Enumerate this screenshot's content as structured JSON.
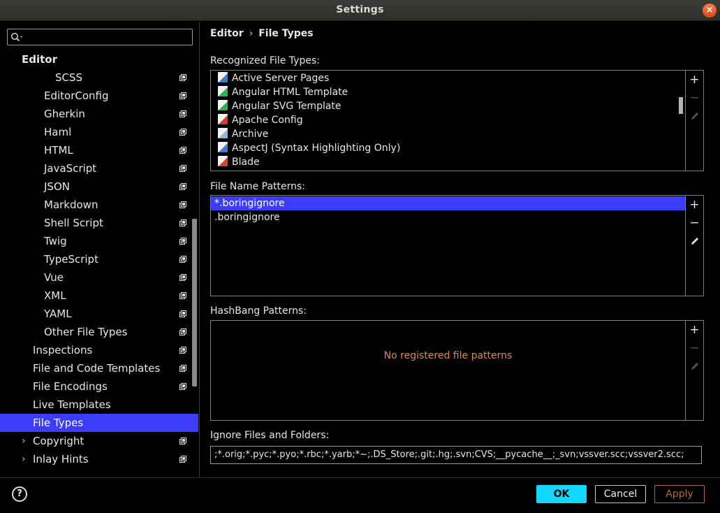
{
  "window": {
    "title": "Settings"
  },
  "search": {
    "placeholder": ""
  },
  "sidebar": {
    "section": "Editor",
    "items": [
      {
        "label": "SCSS",
        "indent": 3
      },
      {
        "label": "EditorConfig",
        "indent": 2
      },
      {
        "label": "Gherkin",
        "indent": 2
      },
      {
        "label": "Haml",
        "indent": 2
      },
      {
        "label": "HTML",
        "indent": 2
      },
      {
        "label": "JavaScript",
        "indent": 2
      },
      {
        "label": "JSON",
        "indent": 2
      },
      {
        "label": "Markdown",
        "indent": 2
      },
      {
        "label": "Shell Script",
        "indent": 2
      },
      {
        "label": "Twig",
        "indent": 2
      },
      {
        "label": "TypeScript",
        "indent": 2
      },
      {
        "label": "Vue",
        "indent": 2
      },
      {
        "label": "XML",
        "indent": 2
      },
      {
        "label": "YAML",
        "indent": 2
      },
      {
        "label": "Other File Types",
        "indent": 2
      },
      {
        "label": "Inspections",
        "indent": 1
      },
      {
        "label": "File and Code Templates",
        "indent": 1
      },
      {
        "label": "File Encodings",
        "indent": 1
      },
      {
        "label": "Live Templates",
        "indent": 1
      },
      {
        "label": "File Types",
        "indent": 1
      },
      {
        "label": "Copyright",
        "indent": 1
      },
      {
        "label": "Inlay Hints",
        "indent": 1
      }
    ]
  },
  "breadcrumb": {
    "parent": "Editor",
    "current": "File Types"
  },
  "recognized": {
    "label": "Recognized File Types:",
    "items": [
      {
        "label": "Active Server Pages",
        "icon": "asp-file-icon",
        "color": "#3d7fd6"
      },
      {
        "label": "Angular HTML Template",
        "icon": "angular-html-icon",
        "color": "#2fb34a"
      },
      {
        "label": "Angular SVG Template",
        "icon": "angular-svg-icon",
        "color": "#2fb34a"
      },
      {
        "label": "Apache Config",
        "icon": "apache-config-icon",
        "color": "#d23a2a"
      },
      {
        "label": "Archive",
        "icon": "archive-icon",
        "color": "#8fb7e0"
      },
      {
        "label": "AspectJ (Syntax Highlighting Only)",
        "icon": "aspectj-icon",
        "color": "#3d7fd6"
      },
      {
        "label": "Blade",
        "icon": "blade-icon",
        "color": "#e0412f"
      }
    ]
  },
  "patterns": {
    "label": "File Name Patterns:",
    "items": [
      "*.boringignore",
      ".boringignore"
    ]
  },
  "hashbang": {
    "label": "HashBang Patterns:",
    "empty": "No registered file patterns"
  },
  "ignore": {
    "label": "Ignore Files and Folders:",
    "value": ";*.orig;*.pyc;*.pyo;*.rbc;*.yarb;*~;.DS_Store;.git;.hg;.svn;CVS;__pycache__;_svn;vssver.scc;vssver2.scc;"
  },
  "footer": {
    "help": "?",
    "ok": "OK",
    "cancel": "Cancel",
    "apply": "Apply"
  },
  "colors": {
    "selection": "#3c3cfa",
    "ok": "#12d8ff",
    "apply": "#b06a37",
    "empty_text": "#d58b4a"
  }
}
